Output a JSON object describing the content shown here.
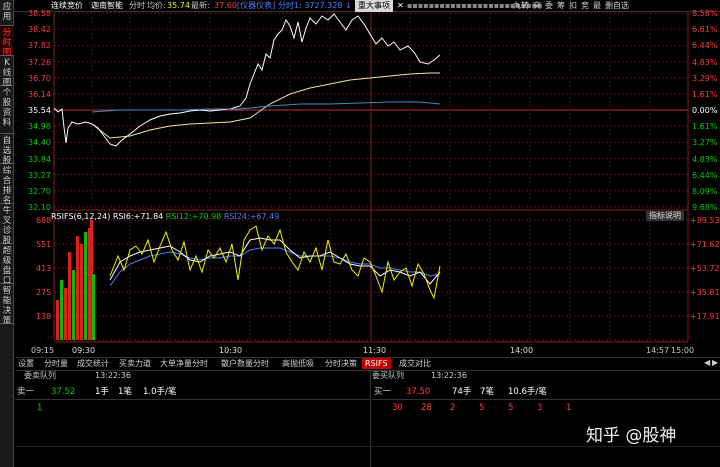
{
  "sidebar": {
    "tabs": [
      {
        "label": "应用"
      },
      {
        "label": "分时图"
      },
      {
        "label": "K线图"
      },
      {
        "label": "个股资料"
      },
      {
        "label": "自选股"
      },
      {
        "label": "综合排名"
      },
      {
        "label": "牛叉诊股"
      },
      {
        "label": "超级盘口"
      },
      {
        "label": "智能决策"
      }
    ]
  },
  "topbar": {
    "mode": "连续竞价",
    "stock_name": "迦南智能",
    "view": "分时",
    "avg_label": "均价:",
    "avg_value": "35.74",
    "latest_label": "最新:",
    "latest_value": "37.60",
    "instrument": "[仪器仪表]",
    "ticker": "分时1: 3727.328",
    "event_button": "重大事项",
    "right_tabs": [
      "九转",
      "突",
      "委",
      "筹",
      "扣",
      "竞",
      "最",
      "删自选"
    ]
  },
  "price_axis": {
    "left": [
      "38.58",
      "38.42",
      "37.82",
      "37.26",
      "36.70",
      "36.14",
      "35.54",
      "34.98",
      "34.40",
      "33.84",
      "33.27",
      "32.70",
      "32.10"
    ],
    "right": [
      "8.58%",
      "6.61%",
      "6.44%",
      "4.83%",
      "3.29%",
      "1.61%",
      "0.00%",
      "1.61%",
      "3.27%",
      "4.83%",
      "6.44%",
      "8.09%",
      "9.68%"
    ]
  },
  "indicator": {
    "name": "RSIFS(6,12,24)",
    "rsi6_label": "RSI6:",
    "rsi6": "+71.84",
    "rsi12_label": "RSI12:",
    "rsi12": "+70.98",
    "rsi24_label": "RSI24:",
    "rsi24": "+67.49",
    "explain": "指标说明",
    "left_ticks": [
      "688",
      "551",
      "413",
      "275",
      "138"
    ],
    "right_ticks": [
      "+89.53",
      "+71.62",
      "+53.72",
      "+35.81",
      "+17.91"
    ]
  },
  "time_axis": [
    "09:15",
    "09:30",
    "10:30",
    "11:30",
    "14:00",
    "14:57",
    "15:00"
  ],
  "bottom_tabs": [
    "设置",
    "分时量",
    "成交统计",
    "买卖力道",
    "大单净量分时",
    "散户数量分时",
    "高抛低吸",
    "分时决策",
    "RSIFS",
    "成交对比"
  ],
  "active_tab": "RSIFS",
  "sell_queue": {
    "title": "委卖队列",
    "time": "13:22:36",
    "label": "卖一",
    "price": "37.52",
    "hands": "1手",
    "orders": "1笔",
    "per": "1.0手/笔",
    "queue": [
      "1"
    ]
  },
  "buy_queue": {
    "title": "委买队列",
    "time": "13:22:36",
    "label": "买一",
    "price": "37.50",
    "hands": "74手",
    "orders": "7笔",
    "per": "10.6手/笔",
    "queue": [
      "30",
      "28",
      "2",
      "5",
      "5",
      "3",
      "1"
    ]
  },
  "watermark": "知乎 @股神"
}
